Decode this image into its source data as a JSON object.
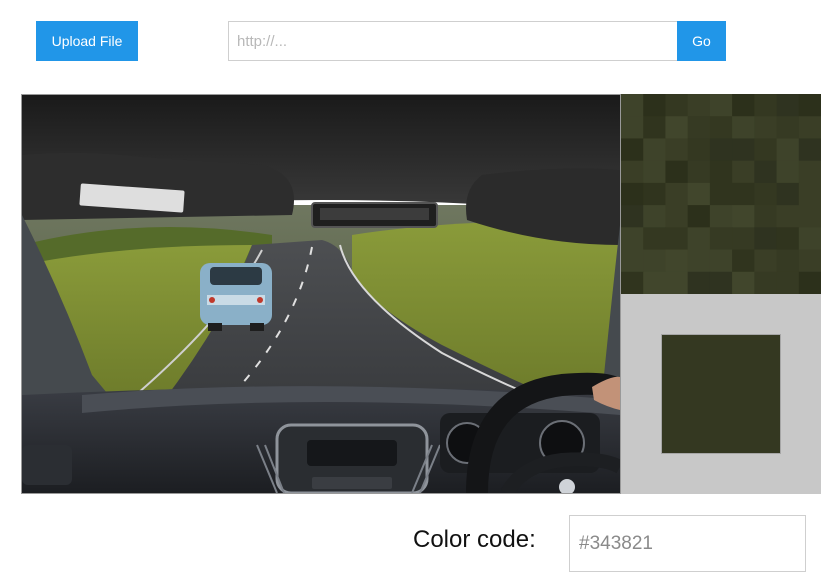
{
  "toolbar": {
    "upload_label": "Upload File",
    "url_placeholder": "http://...",
    "url_value": "",
    "go_label": "Go"
  },
  "picker": {
    "color_label": "Color code:",
    "color_value": "#343821",
    "swatch_color": "#343821"
  },
  "colors": {
    "accent": "#2196e8",
    "swatch_panel_bg": "#c8c8c8"
  }
}
